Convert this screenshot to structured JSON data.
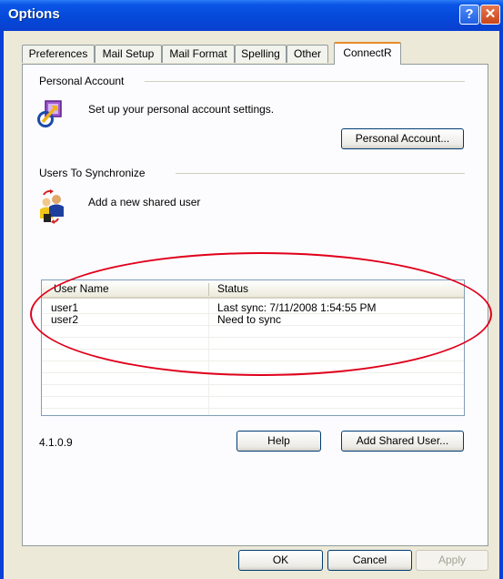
{
  "window": {
    "title": "Options",
    "help_glyph": "?",
    "close_glyph": "✕"
  },
  "tabs": [
    {
      "label": "Preferences"
    },
    {
      "label": "Mail Setup"
    },
    {
      "label": "Mail Format"
    },
    {
      "label": "Spelling"
    },
    {
      "label": "Other"
    },
    {
      "label": "ConnectR",
      "active": true
    }
  ],
  "personal_account": {
    "group_label": "Personal Account",
    "description": "Set up your personal account settings.",
    "button_label": "Personal Account...",
    "icon": "account-settings-icon"
  },
  "users_to_sync": {
    "group_label": "Users To Synchronize",
    "description": "Add a new shared user",
    "icon": "shared-users-icon",
    "columns": [
      "User Name",
      "Status"
    ],
    "rows": [
      {
        "user": "user1",
        "status": "Last sync: 7/11/2008 1:54:55 PM"
      },
      {
        "user": "user2",
        "status": "Need to sync"
      }
    ]
  },
  "footer": {
    "version": "4.1.0.9",
    "help_label": "Help",
    "add_shared_user_label": "Add Shared User..."
  },
  "dialog_buttons": {
    "ok": "OK",
    "cancel": "Cancel",
    "apply": "Apply"
  },
  "colors": {
    "titlebar": "#0a55e6",
    "annotation_oval": "#e0001b",
    "tab_highlight": "#e68b2c"
  }
}
